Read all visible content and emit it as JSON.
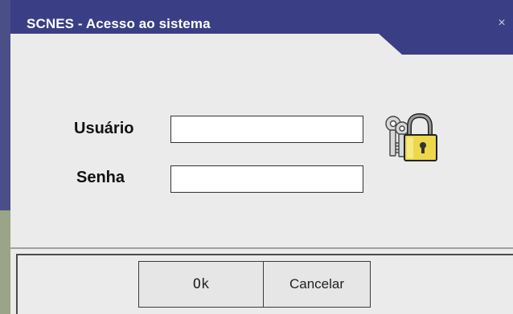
{
  "window": {
    "title": "SCNES - Acesso ao sistema",
    "close_glyph": "×"
  },
  "form": {
    "user_label": "Usuário",
    "user_value": "",
    "password_label": "Senha",
    "password_value": ""
  },
  "buttons": {
    "ok_label": "Ok",
    "cancel_label": "Cancelar"
  },
  "icons": {
    "lock": "keys-padlock-icon"
  },
  "colors": {
    "titlebar": "#3a3f85",
    "background": "#ebebeb"
  }
}
